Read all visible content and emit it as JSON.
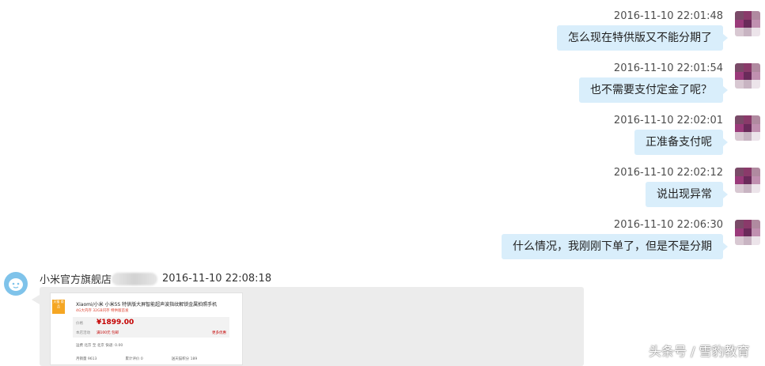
{
  "right_messages": [
    {
      "time": "2016-11-10 22:01:48",
      "text": "怎么现在特供版又不能分期了"
    },
    {
      "time": "2016-11-10 22:01:54",
      "text": "也不需要支付定金了呢？"
    },
    {
      "time": "2016-11-10 22:02:01",
      "text": "正准备支付呢"
    },
    {
      "time": "2016-11-10 22:02:12",
      "text": "说出现异常"
    },
    {
      "time": "2016-11-10 22:06:30",
      "text": "什么情况，我刚刚下单了，但是不是分期"
    }
  ],
  "left_message": {
    "sender": "小米官方旗舰店",
    "time": "2016-11-10 22:08:18",
    "product_card": {
      "tag": "天猫 商品",
      "title": "Xiaomi/小米 小米5S 特供版大屏智能超声波指纹解锁金属拍照手机",
      "subtitle": "4G大内存 32GB闪存 特供版首发",
      "price_label": "价格",
      "price": "¥1899.00",
      "promo_label": "本店活动",
      "promo": "满100元 包邮",
      "more": "更多优惠",
      "spec": "运费     北京 至 北京     快递: 0.00",
      "stats": [
        "月销量 9613",
        "累计评价 0",
        "送天猫积分 189"
      ]
    }
  },
  "watermark": "头条号 / 雪豹教育"
}
